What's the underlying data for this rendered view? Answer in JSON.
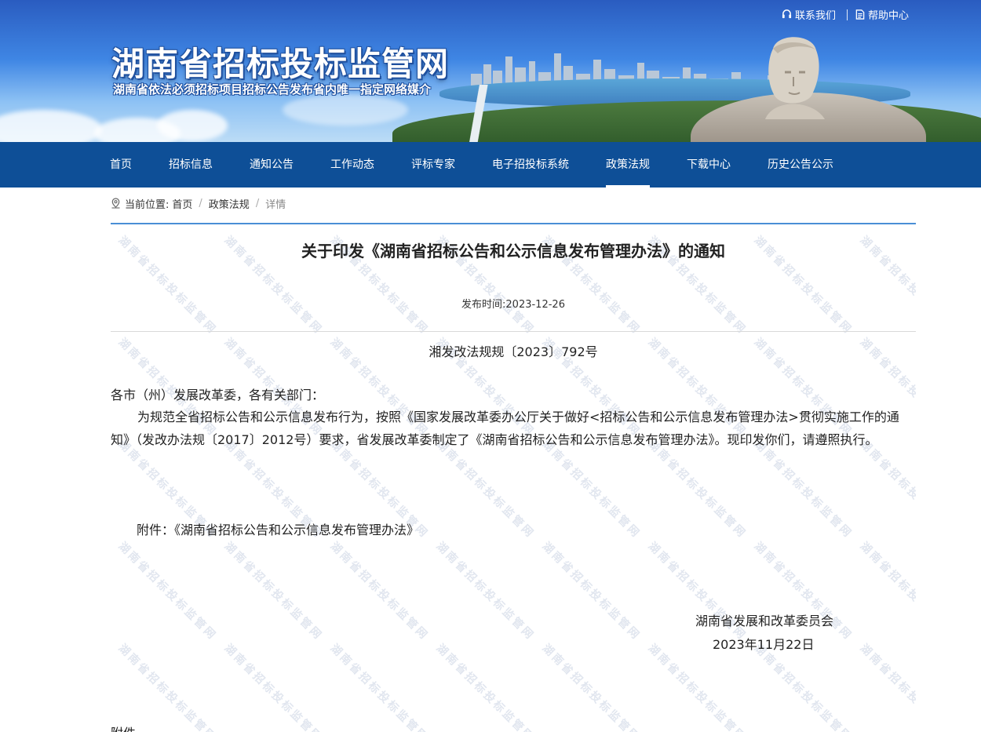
{
  "header": {
    "site_title": "湖南省招标投标监管网",
    "site_subtitle": "湖南省依法必须招标项目招标公告发布省内唯一指定网络媒介",
    "top_links": {
      "contact": "联系我们",
      "help": "帮助中心"
    }
  },
  "nav": {
    "items": [
      {
        "label": "首页"
      },
      {
        "label": "招标信息"
      },
      {
        "label": "通知公告"
      },
      {
        "label": "工作动态"
      },
      {
        "label": "评标专家"
      },
      {
        "label": "电子招投标系统"
      },
      {
        "label": "政策法规"
      },
      {
        "label": "下载中心"
      },
      {
        "label": "历史公告公示"
      }
    ],
    "active": "政策法规"
  },
  "breadcrumb": {
    "prefix": "当前位置:",
    "home": "首页",
    "section": "政策法规",
    "current": "详情"
  },
  "article": {
    "title": "关于印发《湖南省招标公告和公示信息发布管理办法》的通知",
    "publish_time": "发布时间:2023-12-26",
    "doc_number": "湘发改法规规〔2023〕792号",
    "salutation": "各市（州）发展改革委，各有关部门：",
    "paragraph": "为规范全省招标公告和公示信息发布行为，按照《国家发展改革委办公厅关于做好<招标公告和公示信息发布管理办法>贯彻实施工作的通知》（发改办法规〔2017〕2012号）要求，省发展改革委制定了《湖南省招标公告和公示信息发布管理办法》。现印发你们，请遵照执行。",
    "attachment": "附件：《湖南省招标公告和公示信息发布管理办法》",
    "signature_org": "湖南省发展和改革委员会",
    "signature_date": "2023年11月22日",
    "bottom_label": "附件"
  },
  "watermark_text": "湖南省招标投标监管网",
  "colors": {
    "nav_bg": "#0e4f97",
    "rule_blue": "#4a8fd6",
    "text": "#222222"
  }
}
